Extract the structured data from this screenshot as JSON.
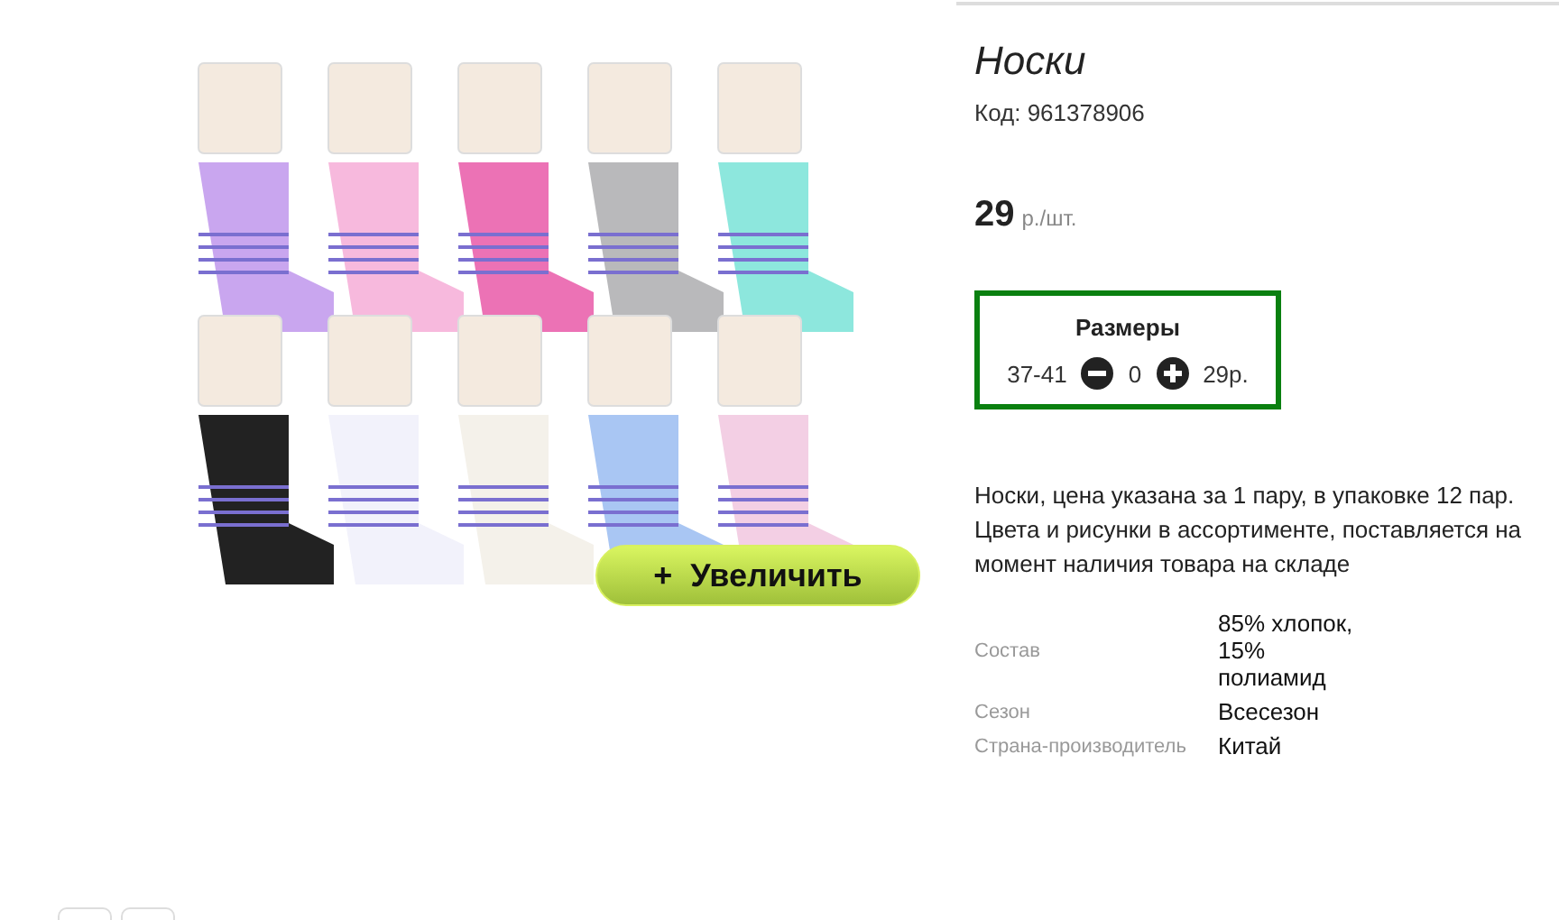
{
  "product": {
    "title": "Носки",
    "code": "Код: 961378906",
    "price": "29",
    "price_unit": "р./шт.",
    "zoom_button": "+  Увеличить"
  },
  "sizes": {
    "title": "Размеры",
    "rows": [
      {
        "size": "37-41",
        "quantity": "0",
        "price": "29р."
      }
    ]
  },
  "description": "Носки, цена указана за 1 пару, в упаковке 12 пар. Цвета и рисунки в ассортименте, поставляется на момент наличия товара на складе",
  "properties": [
    {
      "name": "Состав",
      "value": "85% хлопок, 15% полиамид"
    },
    {
      "name": "Сезон",
      "value": "Всесезон"
    },
    {
      "name": "Страна-производитель",
      "value": "Китай"
    }
  ]
}
